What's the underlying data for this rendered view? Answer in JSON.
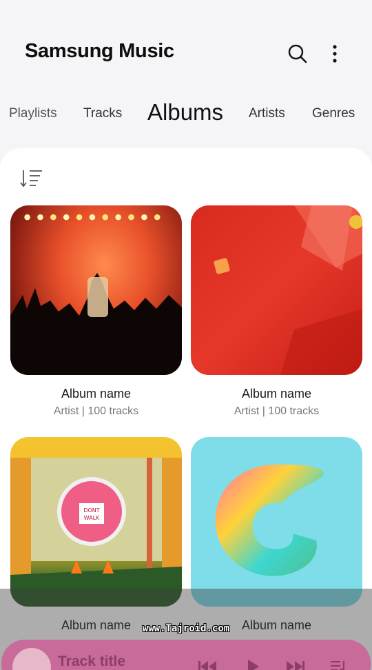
{
  "app": {
    "title": "Samsung Music"
  },
  "header": {
    "search_icon": "search-icon",
    "more_icon": "more-options-icon"
  },
  "tabs": [
    {
      "label": "Playlists",
      "active": false
    },
    {
      "label": "Tracks",
      "active": false
    },
    {
      "label": "Albums",
      "active": true
    },
    {
      "label": "Artists",
      "active": false
    },
    {
      "label": "Genres",
      "active": false
    }
  ],
  "toolbar": {
    "sort_icon": "sort-icon"
  },
  "albums": [
    {
      "name": "Album name",
      "meta": "Artist | 100 tracks"
    },
    {
      "name": "Album name",
      "meta": "Artist | 100 tracks"
    },
    {
      "name": "Album name",
      "meta": ""
    },
    {
      "name": "Album name",
      "meta": ""
    }
  ],
  "art_text": {
    "sign": "DONT WALK"
  },
  "watermark": "www.Tajroid.com",
  "mini_player": {
    "track_title": "Track title"
  },
  "colors": {
    "background": "#f5f5f7",
    "panel": "#ffffff",
    "player": "#c86a9a"
  }
}
